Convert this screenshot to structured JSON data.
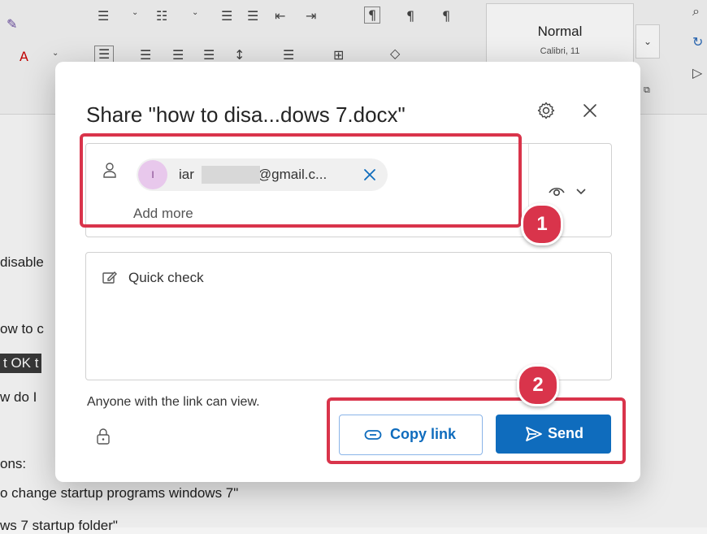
{
  "ribbon": {
    "style_name": "Normal",
    "style_font": "Calibri, 11"
  },
  "document": {
    "lines": [
      "disable",
      "ow to c",
      "t OK t",
      "w do I",
      "ons:",
      "o change startup programs windows 7\"",
      "ws 7 startup folder\""
    ]
  },
  "dialog": {
    "title": "Share \"how to disa...dows 7.docx\"",
    "recipient": {
      "avatar_initial": "I",
      "email_prefix": "iar",
      "email_suffix": "@gmail.c..."
    },
    "add_more_placeholder": "Add more",
    "message": "Quick check",
    "link_info": "Anyone with the link can view.",
    "copy_link_label": "Copy link",
    "send_label": "Send"
  },
  "annotations": {
    "badge_1": "1",
    "badge_2": "2"
  },
  "colors": {
    "accent": "#0f6cbd",
    "annotation": "#d9344b",
    "avatar_bg": "#e8c8ec"
  }
}
